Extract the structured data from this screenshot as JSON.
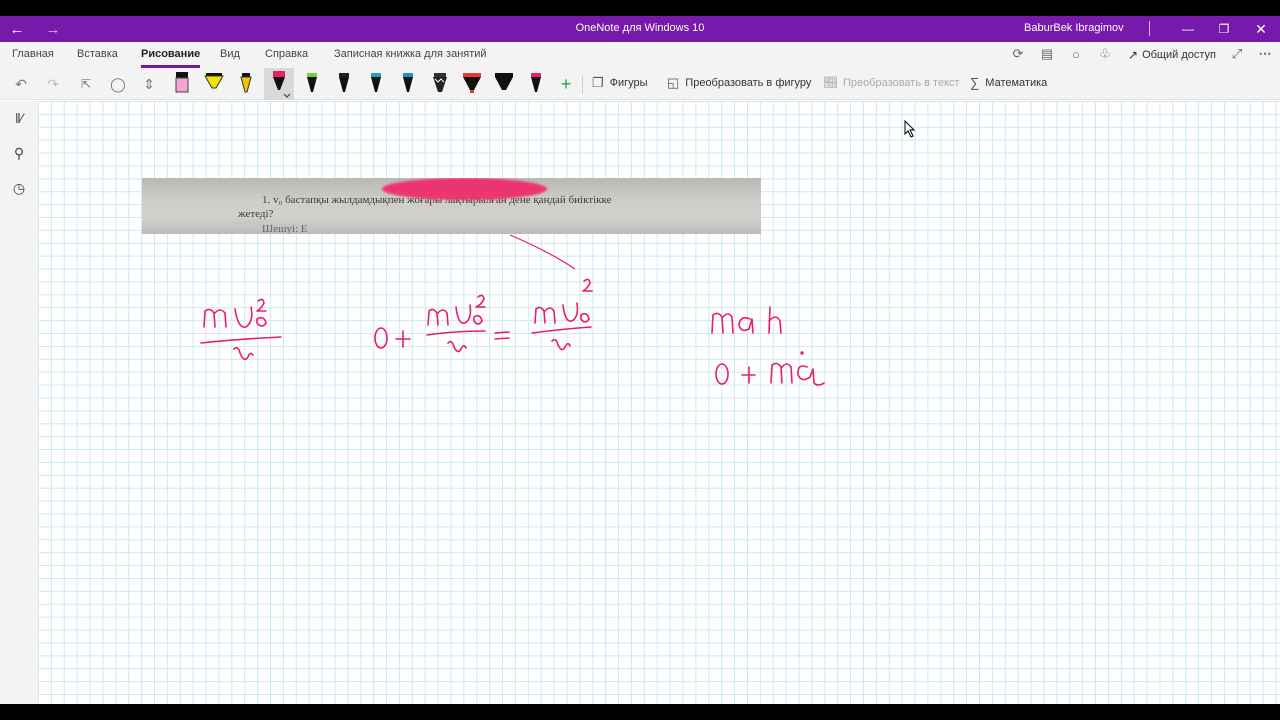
{
  "titlebar": {
    "title": "OneNote для Windows 10",
    "user": "BaburBek Ibragimov"
  },
  "tabs": [
    "Главная",
    "Вставка",
    "Рисование",
    "Вид",
    "Справка",
    "Записная книжка для занятий"
  ],
  "active_tab": "Рисование",
  "share_label": "Общий доступ",
  "toolbar": {
    "shapes_label": "Фигуры",
    "ink_to_shape_label": "Преобразовать в фигуру",
    "ink_to_text_label": "Преобразовать в текст",
    "math_label": "Математика"
  },
  "colors": {
    "accent": "#7719aa",
    "ink": "#e91e63"
  },
  "page": {
    "photo_text_line1": "1. v₀ бастапқы жылдамдықпен жоғары лақтырылған дене қандай биіктікке",
    "photo_text_line2": "жетеді?",
    "photo_text_line3": "Шешуі: Е"
  },
  "ink_notes": [
    "mv₀²/2",
    "0 + mv₀²/2 = mv²/2",
    "mgh",
    "0 + mg"
  ]
}
